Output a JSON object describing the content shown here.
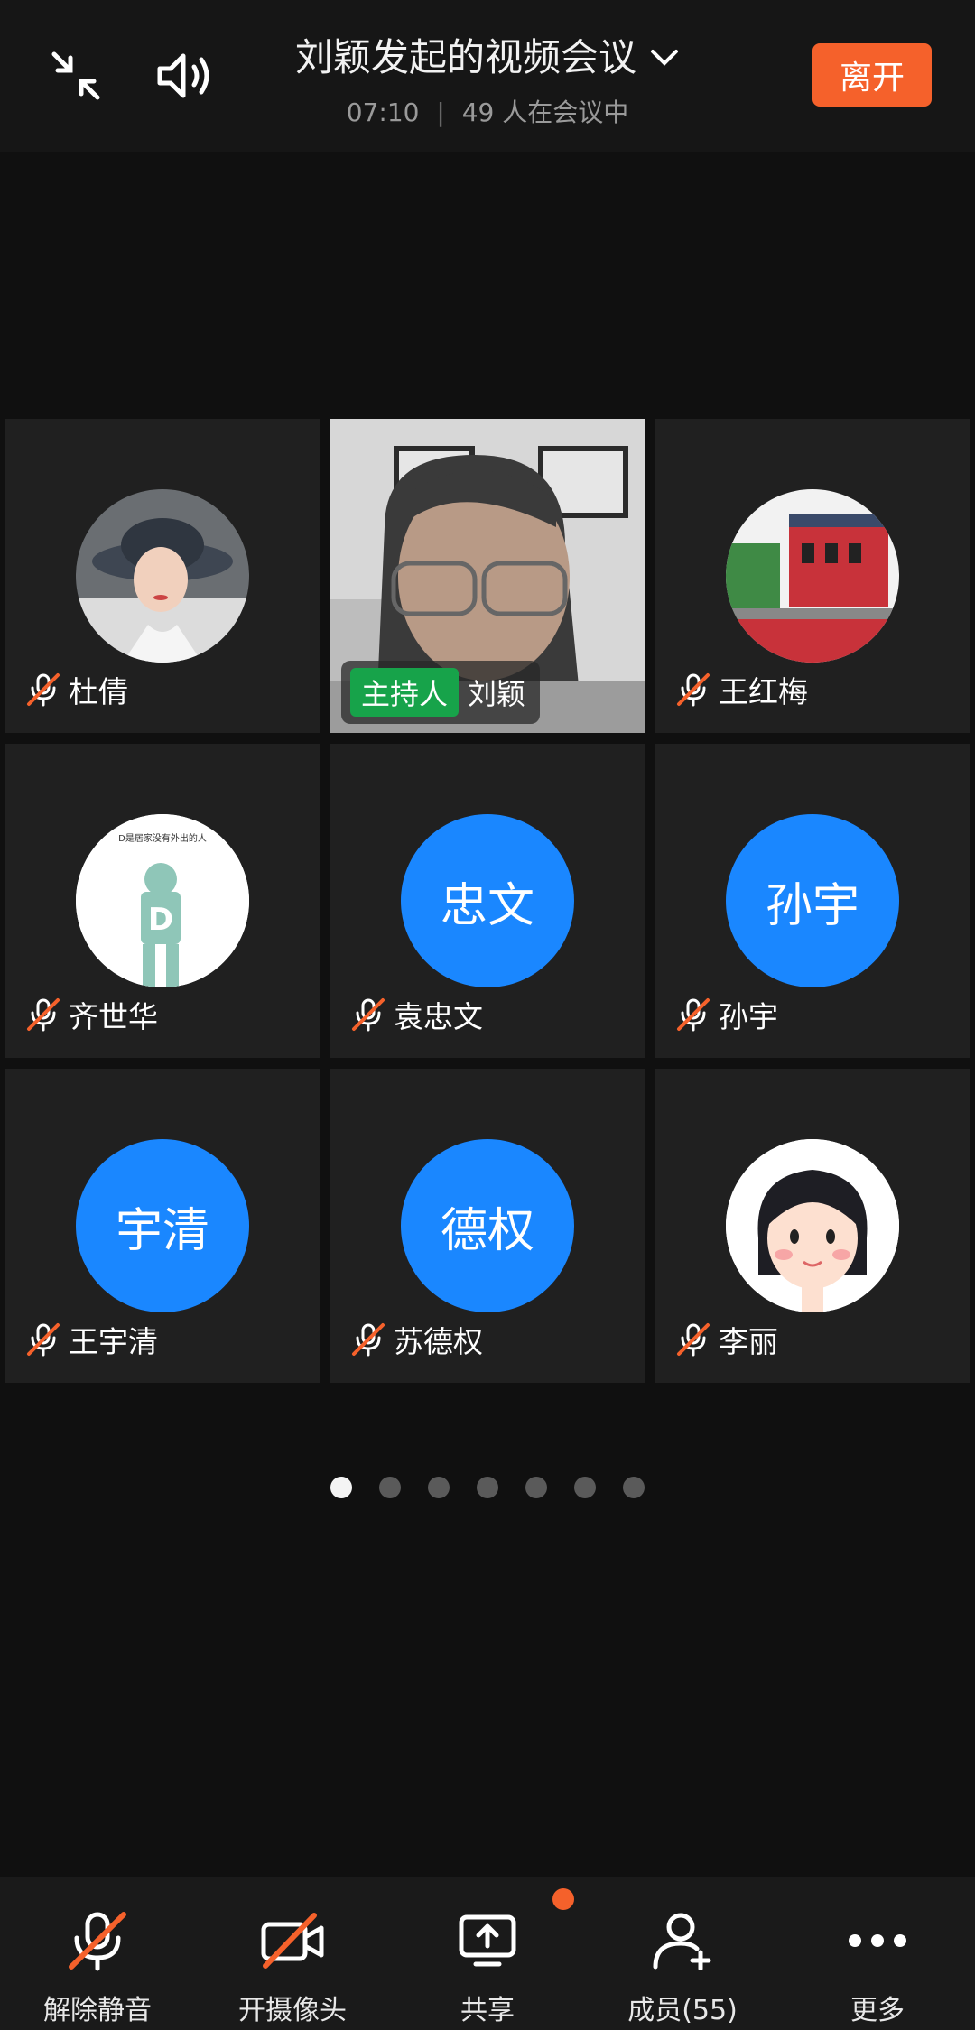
{
  "header": {
    "title": "刘颖发起的视频会议",
    "duration": "07:10",
    "participants": "49 人在会议中",
    "leave_label": "离开"
  },
  "tiles": [
    {
      "name": "杜倩",
      "avatar_type": "photo",
      "avatar_desc": "woman-with-hat"
    },
    {
      "name": "刘颖",
      "host_badge": "主持人",
      "avatar_type": "video"
    },
    {
      "name": "王红梅",
      "avatar_type": "photo",
      "avatar_desc": "painting"
    },
    {
      "name": "齐世华",
      "avatar_type": "photo",
      "avatar_desc": "D-figure"
    },
    {
      "name": "袁忠文",
      "avatar_type": "initials",
      "initials": "忠文"
    },
    {
      "name": "孙宇",
      "avatar_type": "initials",
      "initials": "孙宇"
    },
    {
      "name": "王宇清",
      "avatar_type": "initials",
      "initials": "宇清"
    },
    {
      "name": "苏德权",
      "avatar_type": "initials",
      "initials": "德权"
    },
    {
      "name": "李丽",
      "avatar_type": "cartoon"
    }
  ],
  "avatar_text": {
    "d_figure_caption": "D是居家没有外出的人"
  },
  "pagination": {
    "pages": 7,
    "current": 1
  },
  "toolbar": {
    "unmute": "解除静音",
    "camera": "开摄像头",
    "share": "共享",
    "members": "成员(55)",
    "more": "更多"
  },
  "colors": {
    "accent": "#f5612b",
    "avatar_blue": "#1a87ff",
    "host_green": "#17a34a"
  }
}
